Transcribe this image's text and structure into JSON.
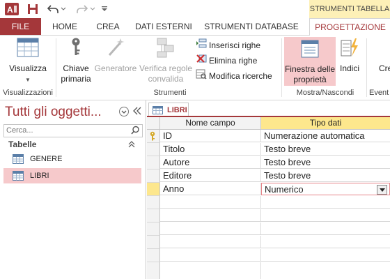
{
  "colors": {
    "accent": "#a4373a",
    "contextual_bg": "#fdf0b7",
    "header_yellow": "#fde78d",
    "nav_selected": "#f6c9cb"
  },
  "quick_access": {
    "icons": [
      "access-logo-icon",
      "save-icon",
      "undo-icon",
      "redo-icon",
      "customize-icon"
    ]
  },
  "contextual_tab_group": "STRUMENTI TABELLA",
  "tabs": {
    "file": "FILE",
    "home": "HOME",
    "crea": "CREA",
    "dati_esterni": "DATI ESTERNI",
    "strumenti_database": "STRUMENTI DATABASE",
    "progettazione": "PROGETTAZIONE"
  },
  "ribbon": {
    "visualizza": "Visualizza",
    "chiave_line1": "Chiave",
    "chiave_line2": "primaria",
    "generatore": "Generatore",
    "verifica_line1": "Verifica regole",
    "verifica_line2": "convalida",
    "inserisci": "Inserisci righe",
    "elimina": "Elimina righe",
    "modifica": "Modifica ricerche",
    "finestra_line1": "Finestra delle",
    "finestra_line2": "proprietà",
    "indici": "Indici",
    "crea_partial": "Cre",
    "groups": {
      "visualizzazioni": "Visualizzazioni",
      "strumenti": "Strumenti",
      "mostra_nascondi": "Mostra/Nascondi",
      "eventi_partial": "Event"
    }
  },
  "nav": {
    "title": "Tutti gli oggetti...",
    "search_placeholder": "Cerca...",
    "section": "Tabelle",
    "items": [
      {
        "label": "GENERE",
        "selected": false
      },
      {
        "label": "LIBRI",
        "selected": true
      }
    ]
  },
  "document_tab": "LIBRI",
  "grid": {
    "headers": {
      "field": "Nome campo",
      "type": "Tipo dati"
    },
    "rows": [
      {
        "field": "ID",
        "type": "Numerazione automatica",
        "primary_key": true
      },
      {
        "field": "Titolo",
        "type": "Testo breve"
      },
      {
        "field": "Autore",
        "type": "Testo breve"
      },
      {
        "field": "Editore",
        "type": "Testo breve"
      },
      {
        "field": "Anno",
        "type": "Numerico",
        "active": true
      }
    ]
  }
}
